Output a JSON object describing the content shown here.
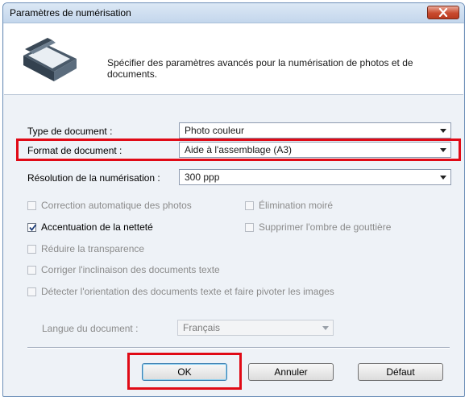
{
  "window": {
    "title": "Paramètres de numérisation"
  },
  "header": {
    "description": "Spécifier des paramètres avancés pour la numérisation de photos et de documents."
  },
  "fields": {
    "document_type": {
      "label": "Type de document :",
      "value": "Photo couleur"
    },
    "document_size": {
      "label": "Format de document :",
      "value": "Aide à l'assemblage (A3)"
    },
    "scan_resolution": {
      "label": "Résolution de la numérisation :",
      "value": "300 ppp"
    }
  },
  "options": {
    "auto_photo_fix": {
      "label": "Correction automatique des photos",
      "checked": false,
      "enabled": false
    },
    "descreen": {
      "label": "Élimination moiré",
      "checked": false,
      "enabled": false
    },
    "unsharp_mask": {
      "label": "Accentuation de la netteté",
      "checked": true,
      "enabled": true
    },
    "remove_gutter_shadow": {
      "label": "Supprimer l'ombre de gouttière",
      "checked": false,
      "enabled": false
    },
    "reduce_show_through": {
      "label": "Réduire la transparence",
      "checked": false,
      "enabled": false
    },
    "correct_slanted_text": {
      "label": "Corriger l'inclinaison des documents texte",
      "checked": false,
      "enabled": false
    },
    "detect_orientation": {
      "label": "Détecter l'orientation des documents texte et faire pivoter les images",
      "checked": false,
      "enabled": false
    }
  },
  "language": {
    "label": "Langue du document :",
    "value": "Français"
  },
  "buttons": {
    "ok": "OK",
    "cancel": "Annuler",
    "defaults": "Défaut"
  },
  "colors": {
    "highlight": "#e00a16",
    "close_button": "#c94a2e"
  }
}
